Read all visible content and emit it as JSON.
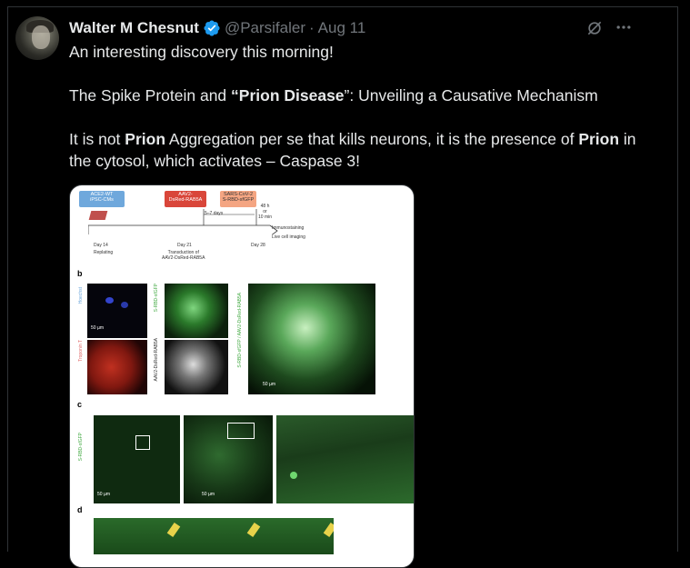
{
  "post": {
    "author_name": "Walter M Chesnut",
    "handle": "@Parsifaler",
    "separator": "·",
    "date": "Aug 11",
    "paragraphs": [
      {
        "parts": [
          {
            "t": "An interesting discovery this morning!",
            "b": false
          }
        ]
      },
      {
        "parts": [
          {
            "t": "The Spike Protein and ",
            "b": false
          },
          {
            "t": "“Prion Disease",
            "b": true
          },
          {
            "t": "”: Unveiling a Causative Mechanism",
            "b": false
          }
        ]
      },
      {
        "parts": [
          {
            "t": "It is not ",
            "b": false
          },
          {
            "t": "Prion",
            "b": true
          },
          {
            "t": " Aggregation per se that kills neurons, it is the presence of ",
            "b": false
          },
          {
            "t": "Prion",
            "b": true
          },
          {
            "t": " in the cytosol, which activates – Caspase 3!",
            "b": false
          }
        ]
      }
    ]
  },
  "icons": {
    "verified": "verified-badge-icon",
    "grok": "grok-icon",
    "more": "more-icon"
  },
  "colors": {
    "background": "#000000",
    "text": "#e7e9ea",
    "muted": "#71767b",
    "verified": "#1d9bf0",
    "border": "#2f3336"
  },
  "figure": {
    "boxes": {
      "ace2": "ACE2-WT\niPSC-CMs",
      "aav": "AAV2-\nDsRed-RAB5A",
      "sars": "SARS-CoV-2\nS-RBD-sfGFP"
    },
    "timeline": {
      "days_5_7": "5–7 days",
      "hours": "48 h\nor\n10 min",
      "day14": "Day 14",
      "replating": "Replating",
      "day21": "Day 21",
      "transduction": "Transduction of\nAAV2-DsRed-RAB5A",
      "day28": "Day 28",
      "immuno": "Immunostaining",
      "live": "Live cell imaging"
    },
    "panel_letters": {
      "b": "b",
      "c": "c",
      "d": "d"
    },
    "panel_b": {
      "hoechst": "Hoechst",
      "troponin": "Troponin T",
      "srbd": "S-RBD-sfGFP",
      "aav_rab": "AAV2-DsRed-RAB5A",
      "merged": "S-RBD-sfGFP / AAV2-DsRed-RAB5A",
      "scale1": "50 µm",
      "scale2": "50 µm"
    },
    "panel_c": {
      "srbd": "S-RBD-sfGFP",
      "scale1": "50 µm",
      "scale2": "50 µm"
    }
  }
}
